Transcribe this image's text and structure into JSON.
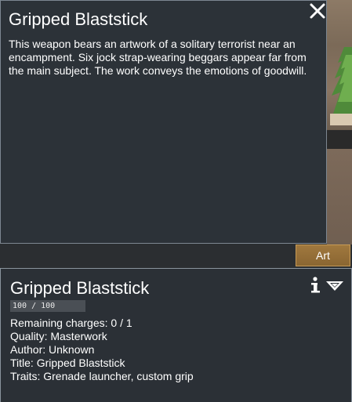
{
  "art_window": {
    "title": "Gripped Blaststick",
    "description": "This weapon bears an artwork of a solitary terrorist near an encampment. Six jock strap-wearing beggars appear far from the main subject. The work conveys the emotions of goodwill."
  },
  "tabs": {
    "art_label": "Art"
  },
  "inspect": {
    "title": "Gripped Blaststick",
    "hit_points_text": "100 / 100",
    "hit_points_fraction": 1.0,
    "stats": [
      "Remaining charges: 0 / 1",
      "Quality: Masterwork",
      "Author: Unknown",
      "Title: Gripped Blaststick",
      "Traits: Grenade launcher, custom grip"
    ]
  },
  "icons": {
    "close": "close-icon",
    "info": "info-icon",
    "collapse": "collapse-triangle-icon"
  },
  "colors": {
    "panel_bg": "#2c3238",
    "tab_bg": "#a0783e",
    "border": "#7d8791"
  }
}
